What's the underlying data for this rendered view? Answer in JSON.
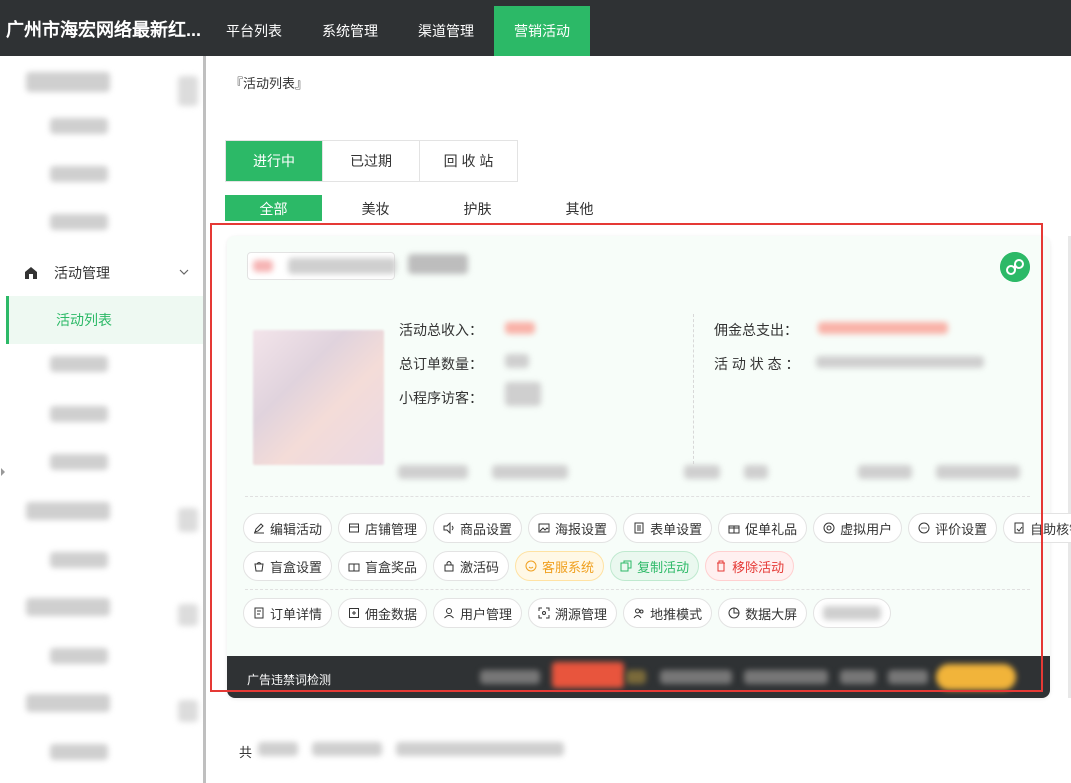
{
  "header": {
    "brand": "广州市海宏网络最新红...",
    "nav": [
      "平台列表",
      "系统管理",
      "渠道管理",
      "营销活动"
    ],
    "active_index": 3
  },
  "sidebar": {
    "group_label": "活动管理",
    "group_icon": "home-icon",
    "active_item": "活动列表"
  },
  "breadcrumb": "『活动列表』",
  "status_tabs": [
    "进行中",
    "已过期",
    "回 收 站"
  ],
  "category_tabs": [
    "全部",
    "美妆",
    "护肤",
    "其他"
  ],
  "activity": {
    "stats_left": [
      "活动总收入：",
      "总订单数量：",
      "小程序访客："
    ],
    "stats_right": [
      "佣金总支出：",
      "活 动 状 态 ："
    ],
    "buttons_row1": [
      "编辑活动",
      "店铺管理",
      "商品设置",
      "海报设置",
      "表单设置",
      "促单礼品",
      "虚拟用户",
      "评价设置",
      "自助核销"
    ],
    "buttons_row2": [
      "盲盒设置",
      "盲盒奖品",
      "激活码",
      "客服系统",
      "复制活动",
      "移除活动"
    ],
    "buttons_row3": [
      "订单详情",
      "佣金数据",
      "用户管理",
      "溯源管理",
      "地推模式",
      "数据大屏"
    ],
    "footer_label": "广告违禁词检测"
  },
  "pager": {
    "prefix": "共"
  },
  "colors": {
    "brand_green": "#2cb967",
    "topbar": "#2f3234",
    "danger": "#e53935",
    "warning": "#f0a020"
  }
}
